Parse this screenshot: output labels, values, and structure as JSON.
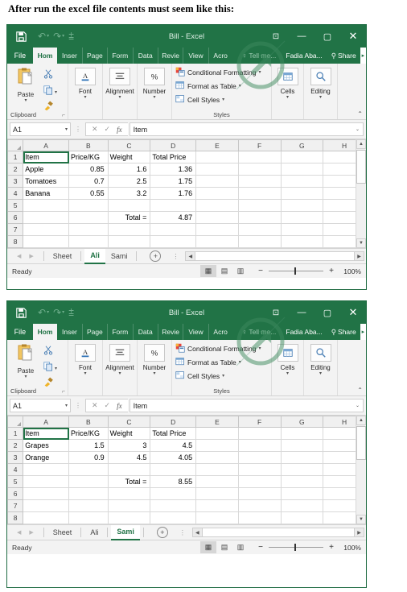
{
  "caption": "After run the excel file contents must seem like this:",
  "window": {
    "title": "Bill - Excel",
    "titlebar_buttons": {
      "save": "save-icon",
      "undo": "undo-icon",
      "redo": "redo-icon",
      "customize": "customize-qat-icon",
      "ribbon_display": "ribbon-display-options",
      "minimize": "minimize",
      "maximize": "maximize",
      "close": "close"
    },
    "tabs": [
      "File",
      "Hom",
      "Inser",
      "Page",
      "Form",
      "Data",
      "Revie",
      "View",
      "Acro"
    ],
    "active_tab": "Hom",
    "tell_me": "Tell me...",
    "user": "Fadia Aba...",
    "share": "Share"
  },
  "ribbon": {
    "clipboard": {
      "paste": "Paste",
      "cut": "cut-icon",
      "copy": "copy-icon",
      "format_painter": "format-painter-icon",
      "label": "Clipboard"
    },
    "font": {
      "label": "Font",
      "icon": "font-icon"
    },
    "alignment": {
      "label": "Alignment",
      "icon": "alignment-icon"
    },
    "number": {
      "label": "Number",
      "icon": "percent-icon"
    },
    "styles": {
      "label": "Styles",
      "items": [
        "Conditional Formatting",
        "Format as Table",
        "Cell Styles"
      ]
    },
    "cells": {
      "label": "Cells",
      "icon": "cells-icon"
    },
    "editing": {
      "label": "Editing",
      "icon": "find-icon"
    }
  },
  "formula_bar": {
    "name_box": "A1",
    "cancel": "cancel-icon",
    "enter": "enter-icon",
    "fx": "fx",
    "value": "Item"
  },
  "grid": {
    "columns": [
      "A",
      "B",
      "C",
      "D",
      "E",
      "F",
      "G",
      "H"
    ]
  },
  "sheet1": {
    "rows": [
      {
        "n": "1",
        "cells": [
          "Item",
          "Price/KG",
          "Weight",
          "Total Price",
          "",
          "",
          "",
          ""
        ]
      },
      {
        "n": "2",
        "cells": [
          "Apple",
          "0.85",
          "1.6",
          "1.36",
          "",
          "",
          "",
          ""
        ]
      },
      {
        "n": "3",
        "cells": [
          "Tomatoes",
          "0.7",
          "2.5",
          "1.75",
          "",
          "",
          "",
          ""
        ]
      },
      {
        "n": "4",
        "cells": [
          "Banana",
          "0.55",
          "3.2",
          "1.76",
          "",
          "",
          "",
          ""
        ]
      },
      {
        "n": "5",
        "cells": [
          "",
          "",
          "",
          "",
          "",
          "",
          "",
          ""
        ]
      },
      {
        "n": "6",
        "cells": [
          "",
          "",
          "Total =",
          "4.87",
          "",
          "",
          "",
          ""
        ]
      },
      {
        "n": "7",
        "cells": [
          "",
          "",
          "",
          "",
          "",
          "",
          "",
          ""
        ]
      },
      {
        "n": "8",
        "cells": [
          "",
          "",
          "",
          "",
          "",
          "",
          "",
          ""
        ]
      }
    ],
    "sheet_tabs": [
      "Sheet",
      "Ali",
      "Sami"
    ],
    "active_sheet": "Ali"
  },
  "sheet2": {
    "rows": [
      {
        "n": "1",
        "cells": [
          "Item",
          "Price/KG",
          "Weight",
          "Total Price",
          "",
          "",
          "",
          ""
        ]
      },
      {
        "n": "2",
        "cells": [
          "Grapes",
          "1.5",
          "3",
          "4.5",
          "",
          "",
          "",
          ""
        ]
      },
      {
        "n": "3",
        "cells": [
          "Orange",
          "0.9",
          "4.5",
          "4.05",
          "",
          "",
          "",
          ""
        ]
      },
      {
        "n": "4",
        "cells": [
          "",
          "",
          "",
          "",
          "",
          "",
          "",
          ""
        ]
      },
      {
        "n": "5",
        "cells": [
          "",
          "",
          "Total =",
          "8.55",
          "",
          "",
          "",
          ""
        ]
      },
      {
        "n": "6",
        "cells": [
          "",
          "",
          "",
          "",
          "",
          "",
          "",
          ""
        ]
      },
      {
        "n": "7",
        "cells": [
          "",
          "",
          "",
          "",
          "",
          "",
          "",
          ""
        ]
      },
      {
        "n": "8",
        "cells": [
          "",
          "",
          "",
          "",
          "",
          "",
          "",
          ""
        ]
      }
    ],
    "sheet_tabs": [
      "Sheet",
      "Ali",
      "Sami"
    ],
    "active_sheet": "Sami"
  },
  "sheetbar": {
    "add_sheet": "+",
    "prev": "prev-sheet",
    "next": "next-sheet"
  },
  "status": {
    "ready": "Ready",
    "zoom": "100%",
    "views": [
      "normal-view",
      "page-layout-view",
      "page-break-view"
    ]
  },
  "colors": {
    "excel_green": "#217346",
    "ribbon_bg": "#f3f3f3",
    "grid_line": "#d9d9d9"
  }
}
